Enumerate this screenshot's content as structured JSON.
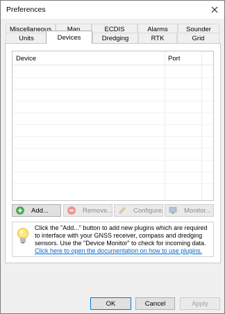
{
  "window": {
    "title": "Preferences"
  },
  "tabs_back_row": [
    {
      "label": "Miscellaneous"
    },
    {
      "label": "Map"
    },
    {
      "label": "ECDIS"
    },
    {
      "label": "Alarms"
    },
    {
      "label": "Sounder"
    }
  ],
  "tabs_front_row": [
    {
      "label": "Units"
    },
    {
      "label": "Devices",
      "active": true
    },
    {
      "label": "Dredging"
    },
    {
      "label": "RTK"
    },
    {
      "label": "Grid"
    }
  ],
  "devices_list": {
    "columns": [
      "Device",
      "Port"
    ],
    "rows": []
  },
  "device_buttons": {
    "add": {
      "label": "Add...",
      "icon": "plus-icon",
      "enabled": true
    },
    "remove": {
      "label": "Remove...",
      "icon": "minus-icon",
      "enabled": false
    },
    "configure": {
      "label": "Configure...",
      "icon": "pencil-icon",
      "enabled": false
    },
    "monitor": {
      "label": "Monitor...",
      "icon": "monitor-icon",
      "enabled": false
    }
  },
  "info": {
    "icon": "lightbulb-icon",
    "text": "Click the \"Add...\" button to add new plugins which are required to interface with your GNSS receiver, compass and dredging sensors. Use the \"Device Monitor\" to check for incoming data.",
    "link": "Click here to open the documentation on how to use plugins."
  },
  "dialog_buttons": {
    "ok": "OK",
    "cancel": "Cancel",
    "apply": "Apply"
  },
  "colors": {
    "accent": "#0078d7",
    "link": "#0066cc",
    "add_icon": "#4caf50",
    "remove_icon": "#e57373"
  }
}
